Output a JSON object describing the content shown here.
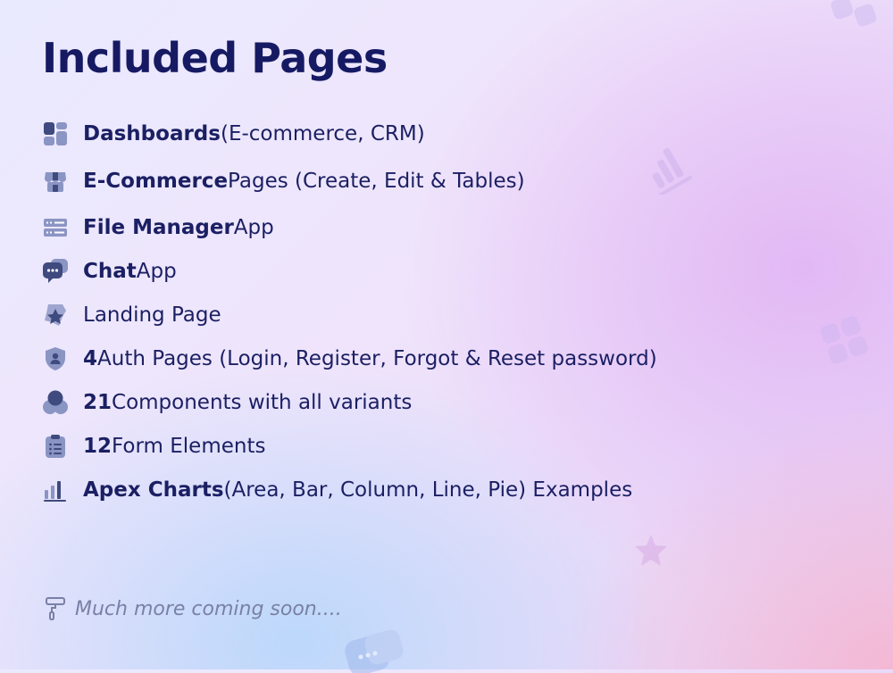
{
  "title": "Included Pages",
  "features": [
    {
      "icon": "grid-icon",
      "bold": "Dashboards",
      "rest": " (E-commerce, CRM)"
    },
    {
      "icon": "shop-icon",
      "bold": "E-Commerce",
      "rest": " Pages (Create, Edit & Tables)"
    },
    {
      "icon": "server-icon",
      "bold": "File Manager",
      "rest": " App"
    },
    {
      "icon": "chat-icon",
      "bold": "Chat",
      "rest": " App"
    },
    {
      "icon": "star-icon",
      "bold": "",
      "rest": "Landing Page"
    },
    {
      "icon": "shield-user-icon",
      "bold": "4",
      "rest": " Auth Pages (Login, Register, Forgot & Reset password)"
    },
    {
      "icon": "circles-icon",
      "bold": "21",
      "rest": " Components with all variants"
    },
    {
      "icon": "clipboard-list-icon",
      "bold": "12",
      "rest": " Form Elements"
    },
    {
      "icon": "bar-chart-icon",
      "bold": "Apex Charts",
      "rest": " (Area, Bar, Column, Line, Pie) Examples"
    }
  ],
  "footer": {
    "icon": "paint-roller-icon",
    "text": "Much more coming soon...."
  },
  "colors": {
    "title": "#161a63",
    "text": "#1b1f63",
    "icon_dark": "#3f4a7e",
    "icon_light": "#8b95c4",
    "footer": "#7a80a6"
  }
}
